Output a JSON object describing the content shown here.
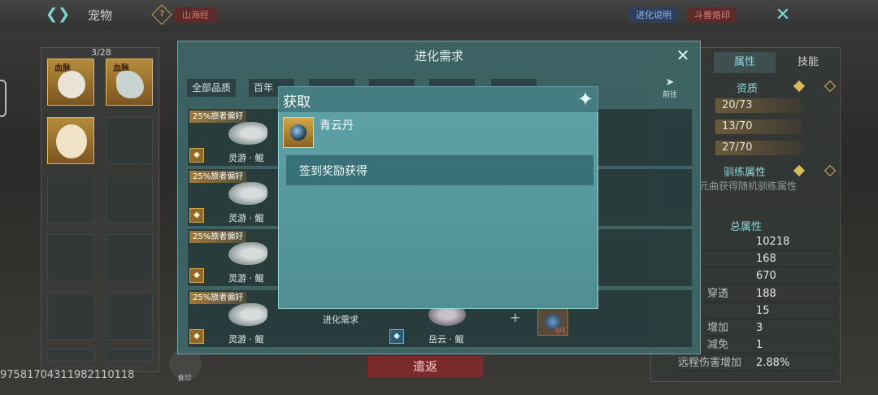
{
  "topbar": {
    "title": "宠物",
    "badge_icon": "7",
    "tag": "山海经",
    "evolution_info_button": "进化说明",
    "beast_mark_button": "斗兽烙印"
  },
  "pet_list": {
    "count": "3/28",
    "slots": [
      {
        "tag": "血脉",
        "kind": "pet"
      },
      {
        "tag": "血脉",
        "kind": "dragon"
      },
      {
        "tag": "",
        "kind": "egg"
      }
    ]
  },
  "pet_id": "975817043119821101​18",
  "bottom_icon_label": "食珍",
  "release_button": "遣返",
  "evolution": {
    "title": "进化需求",
    "filters": [
      "全部品质",
      "百年",
      "",
      "",
      "",
      ""
    ],
    "goto_label": "前往",
    "rows": [
      {
        "pref": "25%旅者偏好",
        "name": "灵游 · 鲲"
      },
      {
        "pref": "25%旅者偏好",
        "name": "灵游 · 鲲"
      },
      {
        "pref": "25%旅者偏好",
        "name": "灵游 · 鲲"
      },
      {
        "pref": "25%旅者偏好",
        "name": "灵游 · 鲲",
        "requirement_label": "进化需求",
        "target_name": "岳云 · 鲲",
        "item_count": "0/1"
      }
    ]
  },
  "attributes": {
    "tabs": [
      "属性",
      "技能"
    ],
    "aptitude_title": "资质",
    "aptitude_values": [
      "20/73",
      "13/70",
      "27/70"
    ],
    "training_title": "驯练属性",
    "training_note": "元曲获得随机驯练属性",
    "total_title": "总属性",
    "stats": [
      {
        "label": "",
        "value": "10218"
      },
      {
        "label": "",
        "value": "168"
      },
      {
        "label": "",
        "value": "670"
      },
      {
        "label": "穿透",
        "value": "188"
      },
      {
        "label": "",
        "value": "15"
      },
      {
        "label": "增加",
        "value": "3"
      },
      {
        "label": "减免",
        "value": "1"
      },
      {
        "label": "远程伤害增加",
        "value": "2.88%"
      }
    ]
  },
  "acquire_popup": {
    "title": "获取",
    "item_name": "青云丹",
    "source": "签到奖励获得"
  }
}
